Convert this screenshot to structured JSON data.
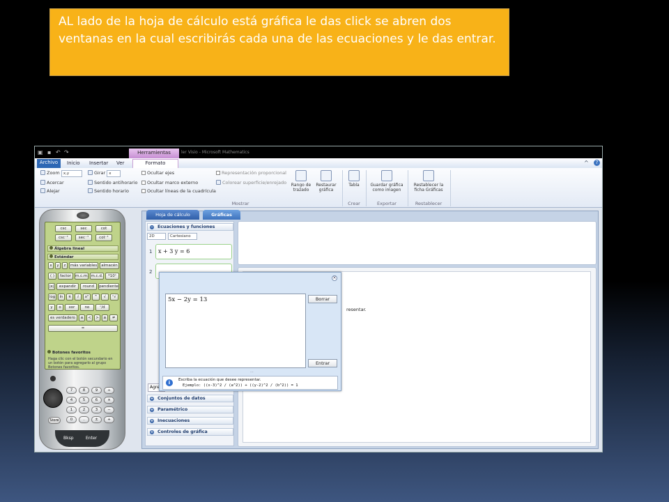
{
  "note": {
    "text": "AL lado de la hoja de cálculo está  gráfica le das click se abren dos ventanas en la cual  escribirás cada una de las ecuaciones y le das entrar."
  },
  "colors": {
    "note_bg": "#f8b218",
    "file_tab": "#2d67b4",
    "context_tab": "#d9a8e2"
  },
  "window": {
    "context_tab": "Herramientas gráficas",
    "title": "ler Visio - Microsoft Mathematics",
    "tabs": [
      "Archivo",
      "Inicio",
      "Insertar",
      "Ver",
      "Formato"
    ],
    "controls": [
      "^",
      "?"
    ]
  },
  "ribbon": {
    "zoom": "Zoom",
    "zoom_val": "x,y",
    "girar": "Girar",
    "girar_val": "x",
    "acercar": "Acercar",
    "alejar": "Alejar",
    "sentido_anti": "Sentido antihorario",
    "sentido_hor": "Sentido horario",
    "ocultar_ejes": "Ocultar ejes",
    "ocultar_marco": "Ocultar marco externo",
    "ocultar_lineas": "Ocultar líneas de la cuadrícula",
    "repr_prop": "Representación proporcional",
    "colorear": "Colorear superficie/enrejado",
    "rango": "Rango de trazado",
    "restaurar": "Restaurar gráfica",
    "tabla": "Tabla",
    "guardar": "Guardar gráfica como imagen",
    "restablecer": "Restablecer la ficha Gráficas",
    "groups": {
      "mostrar": "Mostrar",
      "crear": "Crear",
      "exportar": "Exportar",
      "restablecer": "Restablecer"
    }
  },
  "calculator": {
    "trig": [
      "csc",
      "sec",
      "cot",
      "csc⁻¹",
      "sec⁻¹",
      "cot⁻¹"
    ],
    "algebra": "Álgebra lineal",
    "estandar": "Estándar",
    "row1": [
      "x",
      "y",
      "z",
      "más variables",
      "almacén"
    ],
    "row2": [
      "( )",
      "factor",
      "m.c.m.",
      "m.c.d.",
      "*10ⁿ"
    ],
    "row3": [
      "|x|",
      "expandir",
      "round",
      "pendiente"
    ],
    "row4": [
      "log",
      "ln",
      "π",
      "ⅈ",
      "x²",
      "^",
      "√",
      "ⁿ√"
    ],
    "row5": [
      "y",
      "o",
      "xor",
      "no",
      "ᶜ/d"
    ],
    "row6": [
      "es verdadero",
      "≤",
      "<",
      ">",
      "≥",
      "≠"
    ],
    "row7": "=",
    "favoritos_title": "Botones favoritos",
    "favoritos_text": "Haga clic con el botón secundario en un botón para agregarlo al grupo Botones favoritos.",
    "keys": [
      "7",
      "8",
      "9",
      "÷",
      "4",
      "5",
      "6",
      "×",
      "1",
      "2",
      "3",
      "−",
      "0",
      ".",
      "±",
      "+"
    ],
    "store": "Store",
    "bksp": "Bksp",
    "enter": "Enter"
  },
  "panel": {
    "tab_hoja": "Hoja de cálculo",
    "tab_graficas": "Gráficas",
    "ecuaciones": "Ecuaciones y funciones",
    "mode": "2D",
    "coord": "Cartesiano",
    "eq1_num": "1",
    "eq1": "x + 3 y = 6",
    "eq2_num": "2",
    "agregar": "Agre",
    "conjuntos": "Conjuntos de datos",
    "parametrico": "Paramétrico",
    "inecuaciones": "Inecuaciones",
    "controles": "Controles de gráfica",
    "hint": "resentar."
  },
  "dialog": {
    "equation": "5x − 2y = 13",
    "borrar": "Borrar",
    "entrar": "Entrar",
    "grip": "...",
    "info1": "Escriba la ecuación que desee representar.",
    "info2": "Ejemplo: ((x-3)^2 / (a^2)) + ((y-2)^2 / (b^2)) = 1"
  }
}
